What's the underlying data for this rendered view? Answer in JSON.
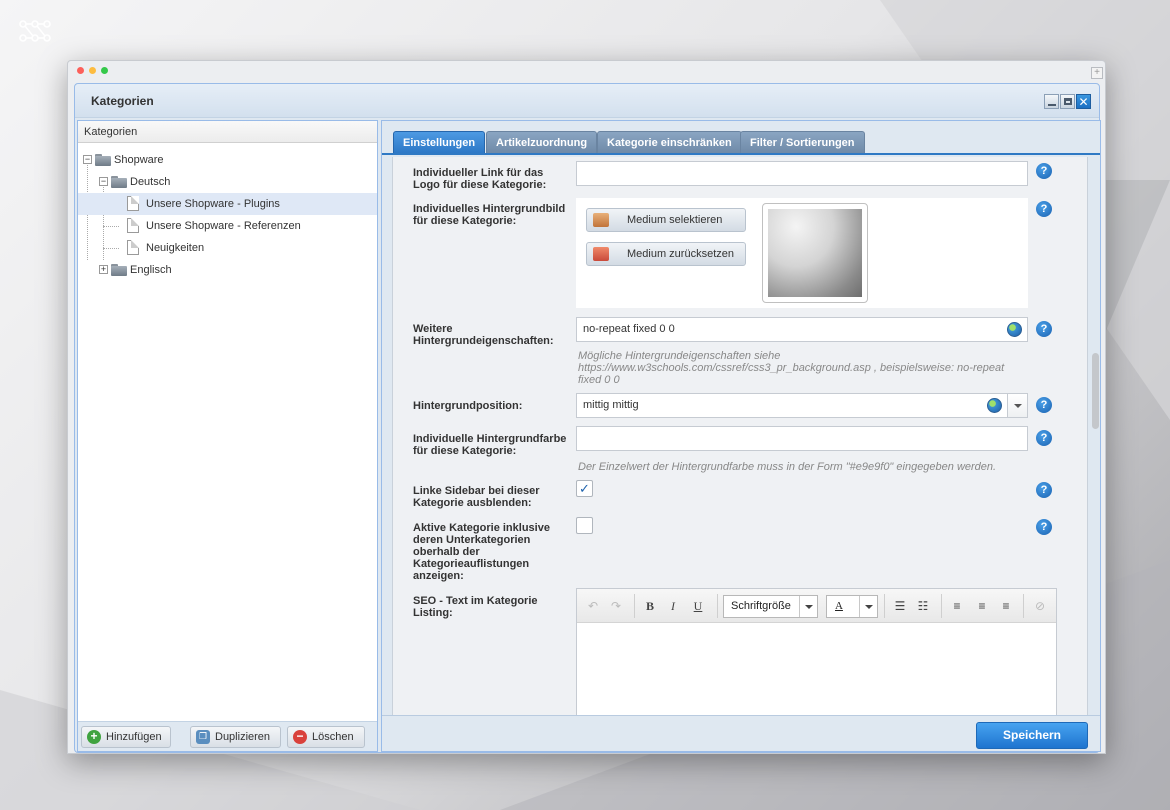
{
  "window": {
    "title": "Kategorien"
  },
  "tree": {
    "header": "Kategorien",
    "items": [
      {
        "label": "Shopware"
      },
      {
        "label": "Deutsch"
      },
      {
        "label": "Unsere Shopware - Plugins",
        "selected": true
      },
      {
        "label": "Unsere Shopware - Referenzen"
      },
      {
        "label": "Neuigkeiten"
      },
      {
        "label": "Englisch"
      }
    ],
    "buttons": {
      "add": "Hinzufügen",
      "duplicate": "Duplizieren",
      "delete": "Löschen"
    }
  },
  "tabs": [
    {
      "label": "Einstellungen",
      "active": true
    },
    {
      "label": "Artikelzuordnung"
    },
    {
      "label": "Kategorie einschränken"
    },
    {
      "label": "Filter / Sortierungen"
    }
  ],
  "form": {
    "logo_link": {
      "label": "Individueller Link für das Logo für diese Kategorie:",
      "value": ""
    },
    "bg_image": {
      "label": "Individuelles Hintergrundbild für diese Kategorie:",
      "select_label": "Medium selektieren",
      "reset_label": "Medium zurücksetzen"
    },
    "bg_props": {
      "label": "Weitere Hintergrundeigenschaften:",
      "value": "no-repeat fixed 0 0",
      "hint": "Mögliche Hintergrundeigenschaften siehe https://www.w3schools.com/cssref/css3_pr_background.asp , beispielsweise: no-repeat fixed 0 0"
    },
    "bg_position": {
      "label": "Hintergrundposition:",
      "value": "mittig mittig"
    },
    "bg_color": {
      "label": "Individuelle Hintergrundfarbe für diese Kategorie:",
      "value": "",
      "hint": "Der Einzelwert der Hintergrundfarbe muss in der Form \"#e9e9f0\" eingegeben werden."
    },
    "hide_sidebar": {
      "label": "Linke Sidebar bei dieser Kategorie ausblenden:",
      "checked": true,
      "mark": "✓"
    },
    "show_active": {
      "label": "Aktive Kategorie inklusive deren Unterkategorien oberhalb der Kategorieauflistungen anzeigen:",
      "checked": false
    },
    "seo_text": {
      "label": "SEO - Text im Kategorie Listing:",
      "font_size_label": "Schriftgröße",
      "bold": "B",
      "italic": "I",
      "underline": "U",
      "font_color": "A"
    }
  },
  "footer": {
    "save_label": "Speichern"
  },
  "colors": {
    "accent": "#2f79c4",
    "tab_inactive": "#7a95b3",
    "save_button": "#2a86dd"
  }
}
